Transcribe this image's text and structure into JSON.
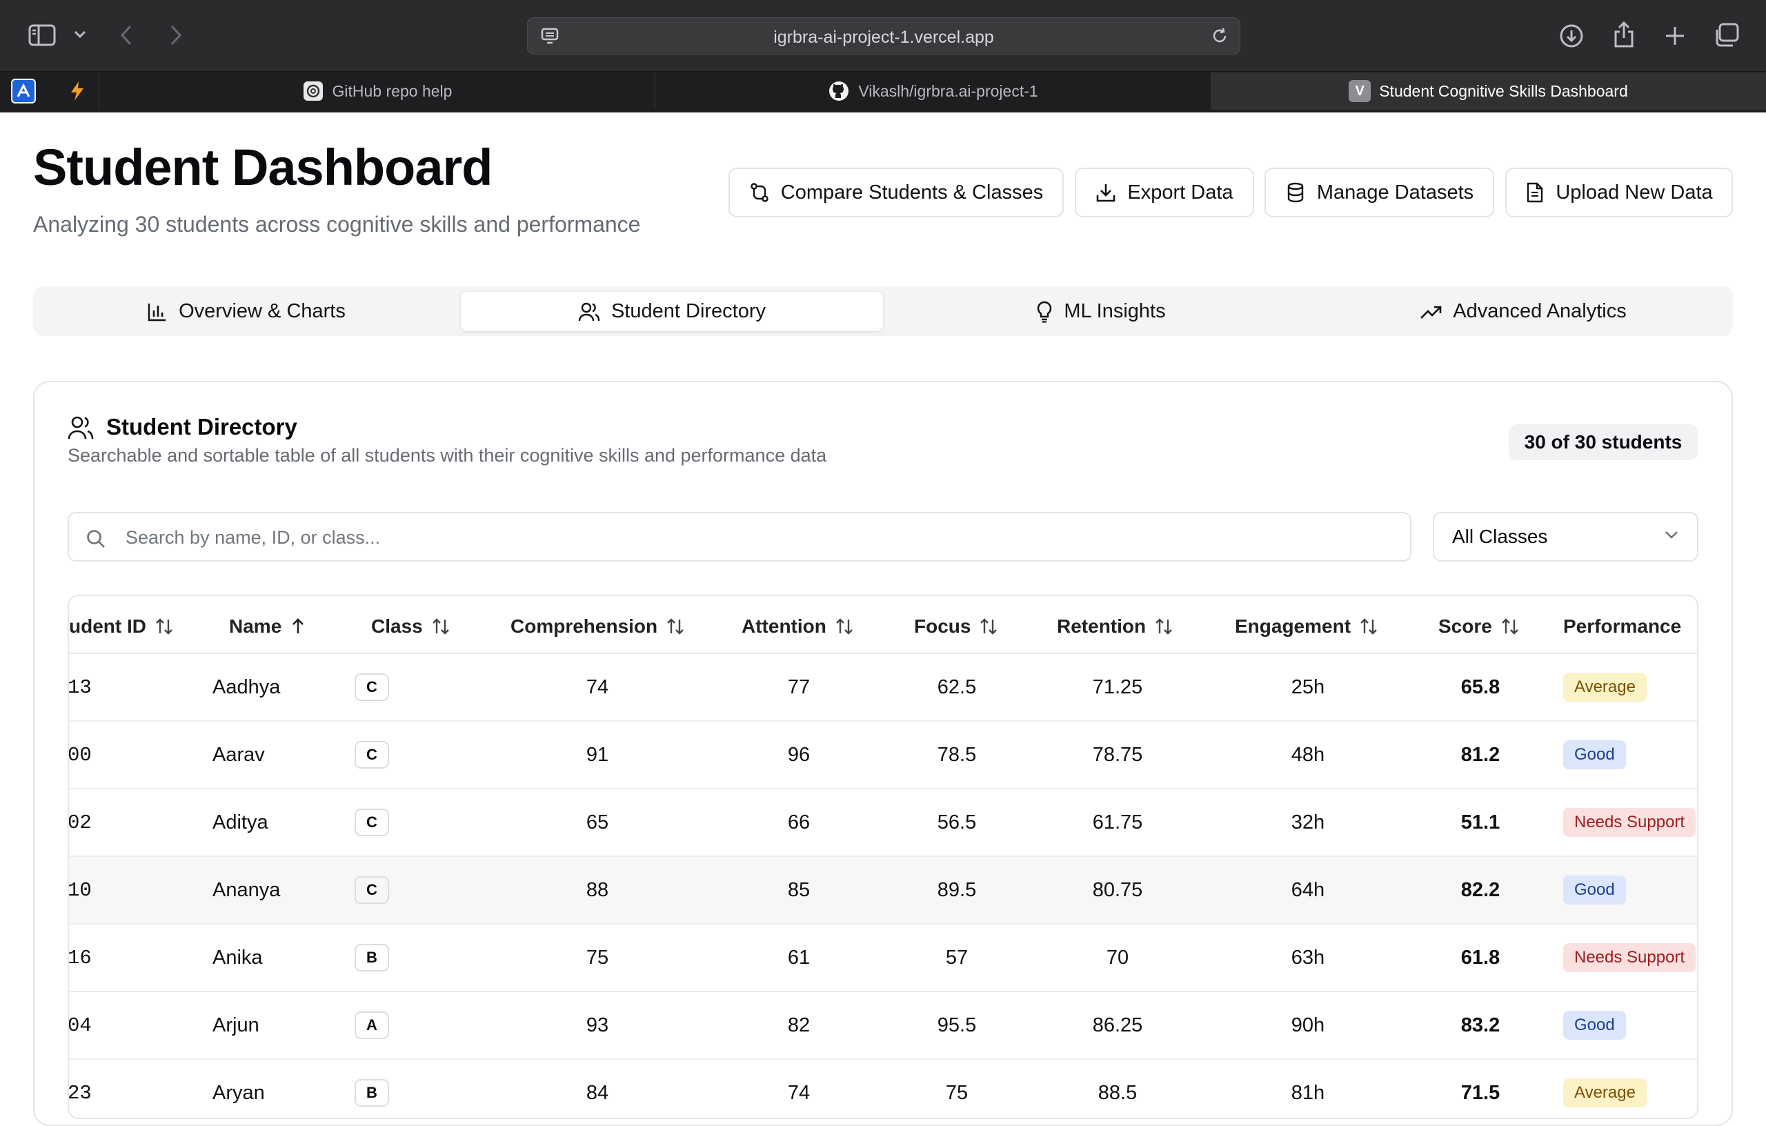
{
  "browser": {
    "url": "igrbra-ai-project-1.vercel.app",
    "tabs": [
      {
        "title": "GitHub repo help"
      },
      {
        "title": "Vikaslh/igrbra.ai-project-1"
      },
      {
        "title": "Student Cognitive Skills Dashboard"
      }
    ],
    "active_tab_badge": "V"
  },
  "header": {
    "title": "Student Dashboard",
    "subtitle": "Analyzing 30 students across cognitive skills and performance"
  },
  "actions": {
    "compare": "Compare Students & Classes",
    "export": "Export Data",
    "manage": "Manage Datasets",
    "upload": "Upload New Data"
  },
  "view_tabs": {
    "overview": "Overview & Charts",
    "directory": "Student Directory",
    "ml": "ML Insights",
    "advanced": "Advanced Analytics",
    "active": "Student Directory"
  },
  "directory": {
    "title": "Student Directory",
    "description": "Searchable and sortable table of all students with their cognitive skills and performance data",
    "count": "30 of 30 students",
    "search_placeholder": "Search by name, ID, or class...",
    "search_value": "",
    "class_filter": "All Classes",
    "columns": {
      "id": "udent ID",
      "name": "Name",
      "class": "Class",
      "comprehension": "Comprehension",
      "attention": "Attention",
      "focus": "Focus",
      "retention": "Retention",
      "engagement": "Engagement",
      "score": "Score",
      "performance": "Performance"
    },
    "rows": [
      {
        "id": "13",
        "name": "Aadhya",
        "class": "C",
        "comprehension": "74",
        "attention": "77",
        "focus": "62.5",
        "retention": "71.25",
        "engagement": "25h",
        "score": "65.8",
        "performance": "Average"
      },
      {
        "id": "00",
        "name": "Aarav",
        "class": "C",
        "comprehension": "91",
        "attention": "96",
        "focus": "78.5",
        "retention": "78.75",
        "engagement": "48h",
        "score": "81.2",
        "performance": "Good"
      },
      {
        "id": "02",
        "name": "Aditya",
        "class": "C",
        "comprehension": "65",
        "attention": "66",
        "focus": "56.5",
        "retention": "61.75",
        "engagement": "32h",
        "score": "51.1",
        "performance": "Needs Support"
      },
      {
        "id": "10",
        "name": "Ananya",
        "class": "C",
        "comprehension": "88",
        "attention": "85",
        "focus": "89.5",
        "retention": "80.75",
        "engagement": "64h",
        "score": "82.2",
        "performance": "Good"
      },
      {
        "id": "16",
        "name": "Anika",
        "class": "B",
        "comprehension": "75",
        "attention": "61",
        "focus": "57",
        "retention": "70",
        "engagement": "63h",
        "score": "61.8",
        "performance": "Needs Support"
      },
      {
        "id": "04",
        "name": "Arjun",
        "class": "A",
        "comprehension": "93",
        "attention": "82",
        "focus": "95.5",
        "retention": "86.25",
        "engagement": "90h",
        "score": "83.2",
        "performance": "Good"
      },
      {
        "id": "23",
        "name": "Aryan",
        "class": "B",
        "comprehension": "84",
        "attention": "74",
        "focus": "75",
        "retention": "88.5",
        "engagement": "81h",
        "score": "71.5",
        "performance": "Average"
      }
    ]
  },
  "colors": {
    "good_bg": "#dbe6fb",
    "average_bg": "#fbf2c6",
    "support_bg": "#fbe0e0"
  }
}
